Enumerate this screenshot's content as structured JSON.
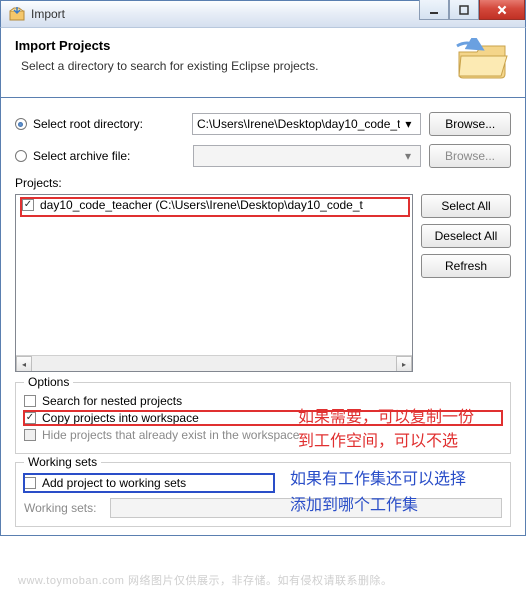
{
  "window": {
    "title": "Import"
  },
  "header": {
    "title": "Import Projects",
    "desc": "Select a directory to search for existing Eclipse projects."
  },
  "source": {
    "root_label": "Select root directory:",
    "archive_label": "Select archive file:",
    "root_path": "C:\\Users\\Irene\\Desktop\\day10_code_t",
    "archive_path": "",
    "browse": "Browse..."
  },
  "projects": {
    "label": "Projects:",
    "items": [
      {
        "checked": true,
        "text": "day10_code_teacher (C:\\Users\\Irene\\Desktop\\day10_code_t"
      }
    ],
    "select_all": "Select All",
    "deselect_all": "Deselect All",
    "refresh": "Refresh"
  },
  "options": {
    "title": "Options",
    "nested": "Search for nested projects",
    "copy": "Copy projects into workspace",
    "hide": "Hide projects that already exist in the workspace"
  },
  "working_sets": {
    "title": "Working sets",
    "add": "Add project to working sets",
    "label": "Working sets:"
  },
  "annotations": {
    "red1": "如果需要，可以复制一份",
    "red2": "到工作空间，可以不选",
    "blue1": "如果有工作集还可以选择",
    "blue2": "添加到哪个工作集"
  },
  "watermark": "www.toymoban.com 网络图片仅供展示，非存储。如有侵权请联系删除。"
}
